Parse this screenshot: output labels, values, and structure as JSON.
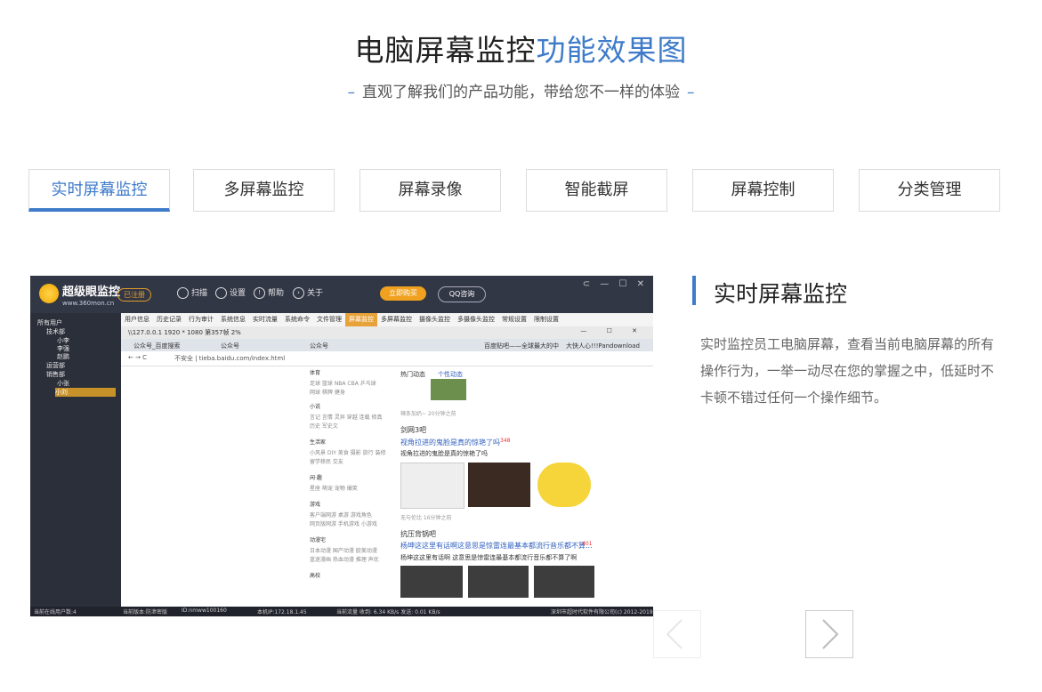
{
  "header": {
    "title_main": "电脑屏幕监控",
    "title_accent": "功能效果图",
    "subtitle": "直观了解我们的产品功能，带给您不一样的体验"
  },
  "tabs": [
    {
      "label": "实时屏幕监控",
      "active": true
    },
    {
      "label": "多屏幕监控",
      "active": false
    },
    {
      "label": "屏幕录像",
      "active": false
    },
    {
      "label": "智能截屏",
      "active": false
    },
    {
      "label": "屏幕控制",
      "active": false
    },
    {
      "label": "分类管理",
      "active": false
    }
  ],
  "screenshot": {
    "brand": "超级眼监控",
    "brand_url": "www.360mon.cn",
    "register": "已注册",
    "nav": [
      "扫描",
      "设置",
      "帮助",
      "关于"
    ],
    "buy": "立即购买",
    "qq": "QQ咨询",
    "window_controls": "⊂ — ☐ ✕",
    "tree": [
      "所有用户",
      "技术部",
      "小李",
      "李强",
      "赵鹏",
      "运营部",
      "销售部",
      "小张",
      "小刘"
    ],
    "commands": [
      "用户信息",
      "历史记录",
      "行为审计",
      "系统信息",
      "实时流量",
      "系统命令",
      "文件管理",
      "屏幕监控",
      "多屏幕监控",
      "摄像头监控",
      "多摄像头监控",
      "常规设置",
      "限制设置"
    ],
    "remote_title": "\\\\127.0.0.1 1920 * 1080 第357帧 2%",
    "browser_tabs": [
      "公众号_百度搜索",
      "公众号",
      "公众号",
      "百度贴吧——全球最大的中",
      "大快人心!!!Pandownload"
    ],
    "address": "不安全 | tieba.baidu.com/index.html",
    "side_cats": [
      "体育",
      "足球 篮球 NBA CBA 乒乓球",
      "网球 棋牌 健身",
      "小说",
      "言记 言情 灵异 穿越 连载 修真",
      "历史 军史文",
      "生活家",
      "小风景 DIY 美食 摄影 旅行 装修",
      "留学移民 交友",
      "闲·趣",
      "星座 萌宠 宠物 爆笑",
      "游戏",
      "客户端网游 桌游 游戏角色",
      "网页版网游 手机游戏 小游戏",
      "动漫宅",
      "日本动漫 国产动漫 欧美动漫",
      "蓝迷漫画 热血动漫 推理 声优",
      "高校"
    ],
    "feed": {
      "tabs": [
        "热门动态",
        "个性动态"
      ],
      "meta1": "辣条加奶~    20分钟之前",
      "bar_name": "剑网3吧",
      "post_title": "视角拉进的鬼脸是真的惊艳了吗",
      "post_count": "348",
      "post_desc": "视角拉进的鬼脸是真的惊艳了吗",
      "meta2": "无与伦比    16分钟之前",
      "bar_name2": "抗压背锅吧",
      "post_title2": "杨坤这这里有话啊这意思是惊雷连最基本都流行音乐都不算...",
      "post_count2": "401",
      "post_desc2": "杨坤这这里有话啊 这意思是惊雷连最基本都流行音乐都不算了啊"
    },
    "status": {
      "online": "当前在线用户数:4",
      "version": "当前版本:防泄密版",
      "id": "ID:nmww100160",
      "ip": "本机IP:172.18.1.45",
      "flow": "当前流量 收到: 6.34 KB/s   发送: 0.01 KB/s",
      "copyright": "深圳市超时代软件有限公司(c) 2012-2019"
    }
  },
  "detail": {
    "title": "实时屏幕监控",
    "text": "实时监控员工电脑屏幕，查看当前电脑屏幕的所有操作行为，一举一动尽在您的掌握之中，低延时不卡顿不错过任何一个操作细节。"
  },
  "icons": {
    "prev": "chevron-left-icon",
    "next": "chevron-right-icon"
  },
  "colors": {
    "accent": "#3e7bc9",
    "app_bg": "#2b2f3a",
    "highlight": "#e8a23a"
  }
}
